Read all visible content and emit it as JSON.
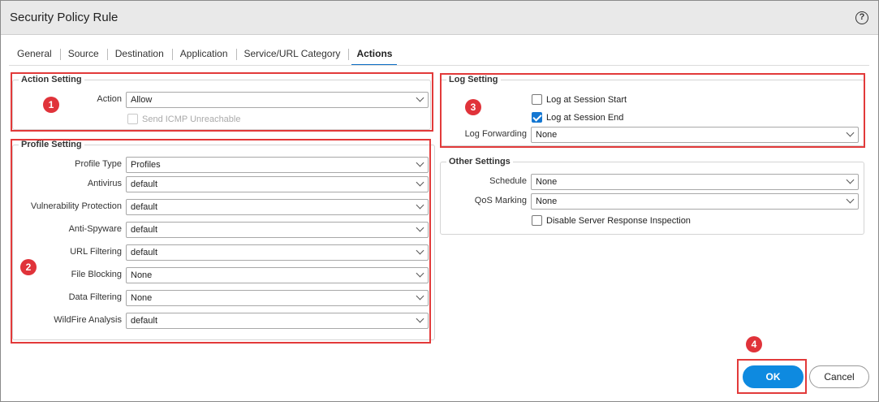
{
  "dialog": {
    "title": "Security Policy Rule",
    "help_glyph": "?"
  },
  "tabs": [
    "General",
    "Source",
    "Destination",
    "Application",
    "Service/URL Category",
    "Actions"
  ],
  "active_tab": "Actions",
  "action_setting": {
    "legend": "Action Setting",
    "action_label": "Action",
    "action_value": "Allow",
    "icmp_label": "Send ICMP Unreachable",
    "icmp_checked": false
  },
  "profile_setting": {
    "legend": "Profile Setting",
    "rows": [
      {
        "label": "Profile Type",
        "value": "Profiles"
      },
      {
        "label": "Antivirus",
        "value": "default"
      },
      {
        "label": "Vulnerability Protection",
        "value": "default"
      },
      {
        "label": "Anti-Spyware",
        "value": "default"
      },
      {
        "label": "URL Filtering",
        "value": "default"
      },
      {
        "label": "File Blocking",
        "value": "None"
      },
      {
        "label": "Data Filtering",
        "value": "None"
      },
      {
        "label": "WildFire Analysis",
        "value": "default"
      }
    ]
  },
  "log_setting": {
    "legend": "Log Setting",
    "session_start_label": "Log at Session Start",
    "session_start_checked": false,
    "session_end_label": "Log at Session End",
    "session_end_checked": true,
    "forwarding_label": "Log Forwarding",
    "forwarding_value": "None"
  },
  "other_settings": {
    "legend": "Other Settings",
    "schedule_label": "Schedule",
    "schedule_value": "None",
    "qos_label": "QoS Marking",
    "qos_value": "None",
    "disable_sri_label": "Disable Server Response Inspection",
    "disable_sri_checked": false
  },
  "annotations": [
    "1",
    "2",
    "3",
    "4"
  ],
  "buttons": {
    "ok": "OK",
    "cancel": "Cancel"
  },
  "colors": {
    "accent": "#0e8ae0",
    "annotation": "#e0333a",
    "titlebar": "#e9e9e9"
  }
}
